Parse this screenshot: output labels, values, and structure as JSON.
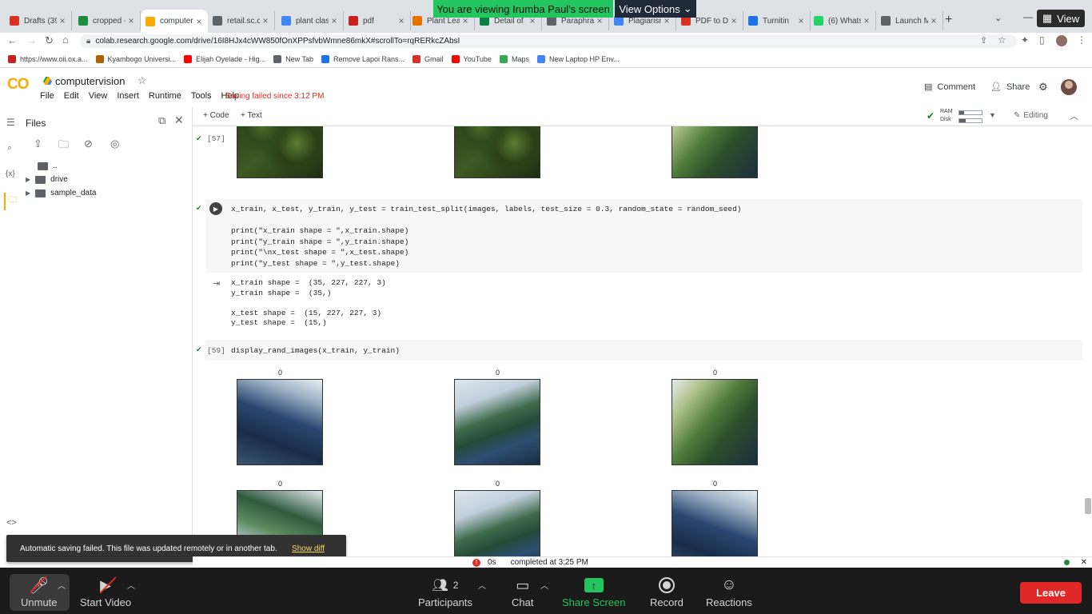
{
  "banner": {
    "viewing": "You are viewing Irumba Paul's screen",
    "view_options": "View Options",
    "view_button": "View"
  },
  "tabs": [
    {
      "label": "Drafts (39",
      "color": "#d93025"
    },
    {
      "label": "cropped -",
      "color": "#1e8e3e"
    },
    {
      "label": "computer",
      "color": "#f9ab00"
    },
    {
      "label": "retail.sc.co",
      "color": "#5f6368"
    },
    {
      "label": "plant clas",
      "color": "#4285f4"
    },
    {
      "label": "pdf",
      "color": "#c5221f"
    },
    {
      "label": "Plant Lea",
      "color": "#e37400"
    },
    {
      "label": "Detail of",
      "color": "#0b8043"
    },
    {
      "label": "Paraphra",
      "color": "#5f6368"
    },
    {
      "label": "Plagiarism",
      "color": "#4285f4"
    },
    {
      "label": "PDF to DO",
      "color": "#d93025"
    },
    {
      "label": "Turnitin",
      "color": "#1a73e8"
    },
    {
      "label": "(6) Whats",
      "color": "#25d366"
    },
    {
      "label": "Launch M",
      "color": "#5f6368"
    }
  ],
  "address": {
    "url": "colab.research.google.com/drive/16I8HJx4cWW850fOnXPPsfvbWmne86mkX#scrollTo=rqRERkcZAbsI"
  },
  "bookmarks": [
    {
      "label": "https://www.oii.ox.a...",
      "color": "#c5221f"
    },
    {
      "label": "Kyambogo Universi...",
      "color": "#b06000"
    },
    {
      "label": "Elijah Oyelade - Hig...",
      "color": "#ff0000"
    },
    {
      "label": "New Tab",
      "color": "#5f6368"
    },
    {
      "label": "Remove Lapoi Rans...",
      "color": "#1a73e8"
    },
    {
      "label": "Gmail",
      "color": "#d93025"
    },
    {
      "label": "YouTube",
      "color": "#ff0000"
    },
    {
      "label": "Maps",
      "color": "#34a853"
    },
    {
      "label": "New Laptop HP Env...",
      "color": "#4285f4"
    }
  ],
  "colab": {
    "logo": "CO",
    "notebook_title": "computervision",
    "menus": [
      "File",
      "Edit",
      "View",
      "Insert",
      "Runtime",
      "Tools",
      "Help"
    ],
    "saving_status": "Saving failed since 3:12 PM",
    "comment": "Comment",
    "share": "Share",
    "ram": "RAM",
    "disk": "Disk",
    "editing": "Editing",
    "add_code": "+ Code",
    "add_text": "+ Text"
  },
  "sidebar": {
    "title": "Files",
    "parent": "..",
    "items": [
      "drive",
      "sample_data"
    ],
    "rail_var": "{x}"
  },
  "cells": {
    "c57_label": "[57]",
    "c58_code": "x_train, x_test, y_train, y_test = train_test_split(images, labels, test_size = 0.3, random_state = random_seed)\n\nprint(\"x_train shape = \",x_train.shape)\nprint(\"y_train shape = \",y_train.shape)\nprint(\"\\nx_test shape = \",x_test.shape)\nprint(\"y_test shape = \",y_test.shape)",
    "c58_output": "x_train shape =  (35, 227, 227, 3)\ny_train shape =  (35,)\n\nx_test shape =  (15, 227, 227, 3)\ny_test shape =  (15,)",
    "c59_label": "[59]",
    "c59_code": "display_rand_images(x_train, y_train)",
    "image_labels": [
      "0",
      "0",
      "0",
      "0",
      "0",
      "0"
    ]
  },
  "toast": {
    "message": "Automatic saving failed. This file was updated remotely or in another tab.",
    "action": "Show diff"
  },
  "status": {
    "duration": "0s",
    "completed": "completed at 3:25 PM"
  },
  "zoom": {
    "unmute": "Unmute",
    "start_video": "Start Video",
    "participants": "Participants",
    "participants_count": "2",
    "chat": "Chat",
    "share_screen": "Share Screen",
    "record": "Record",
    "reactions": "Reactions",
    "leave": "Leave"
  }
}
